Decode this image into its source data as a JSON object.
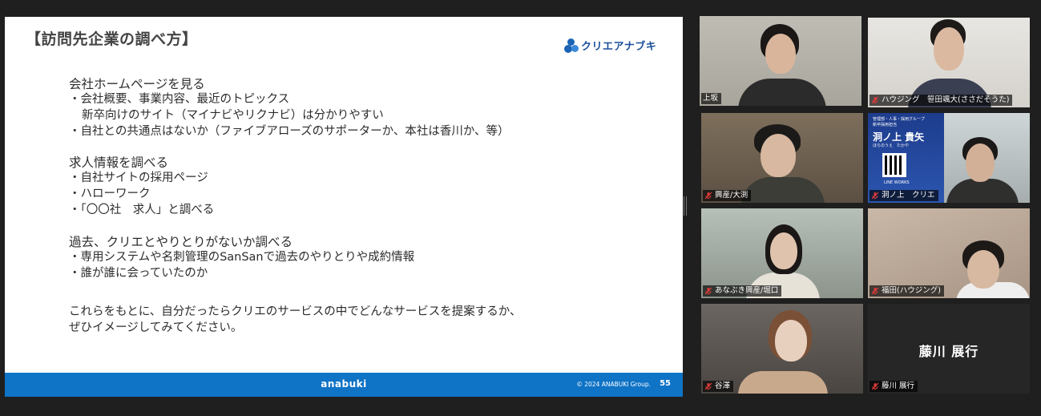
{
  "slide": {
    "title": "【訪問先企業の調べ方】",
    "logo_text": "クリエアナブキ",
    "sections": [
      {
        "heading": "会社ホームページを見る",
        "lines": [
          {
            "text": "・会社概要、事業内容、最近のトピックス",
            "indent": false
          },
          {
            "text": "新卒向けのサイト（マイナビやリクナビ）は分かりやすい",
            "indent": true
          },
          {
            "text": "・自社との共通点はないか（ファイブアローズのサポーターか、本社は香川か、等）",
            "indent": false
          }
        ]
      },
      {
        "heading": "求人情報を調べる",
        "lines": [
          {
            "text": "・自社サイトの採用ページ",
            "indent": false
          },
          {
            "text": "・ハローワーク",
            "indent": false
          },
          {
            "text": "・「〇〇社　求人」と調べる",
            "indent": false
          }
        ]
      },
      {
        "heading": "過去、クリエとやりとりがないか調べる",
        "lines": [
          {
            "text": "・専用システムや名刺管理のSanSanで過去のやりとりや成約情報",
            "indent": false
          },
          {
            "text": "・誰が誰に会っていたのか",
            "indent": false
          }
        ]
      }
    ],
    "closing": [
      "これらをもとに、自分だったらクリエのサービスの中でどんなサービスを提案するか、",
      "ぜひイメージしてみてください。"
    ],
    "footer_brand": "anabuki",
    "footer_copyright": "© 2024 ANABUKI Group.",
    "page_number": "55"
  },
  "participants": [
    {
      "name": "上坂",
      "muted": false,
      "active_speaker": true
    },
    {
      "name": "ハウジング　笹田颯大(ささだそうた)",
      "muted": true
    },
    {
      "name": "興産/大渕",
      "muted": true
    },
    {
      "name": "洞ノ上　クリエ",
      "muted": true
    },
    {
      "name": "あなぶき興産/堀口",
      "muted": true
    },
    {
      "name": "福田(ハウジング)",
      "muted": true
    },
    {
      "name": "谷澤",
      "muted": true
    },
    {
      "name": "藤川 展行",
      "muted": true,
      "display_name": "藤川 展行",
      "video_off": true
    }
  ],
  "virtual_background": {
    "line1": "管理部・人事・採用グループ",
    "line2": "新卒採用担当",
    "name": "洞ノ上 貴矢",
    "line3": "ほらのうえ　たかや",
    "qr_label": "LINE WORKS"
  },
  "colors": {
    "footer_blue": "#0f73c6",
    "active_border": "#c7e14e",
    "muted_mic": "#e23a3a"
  }
}
